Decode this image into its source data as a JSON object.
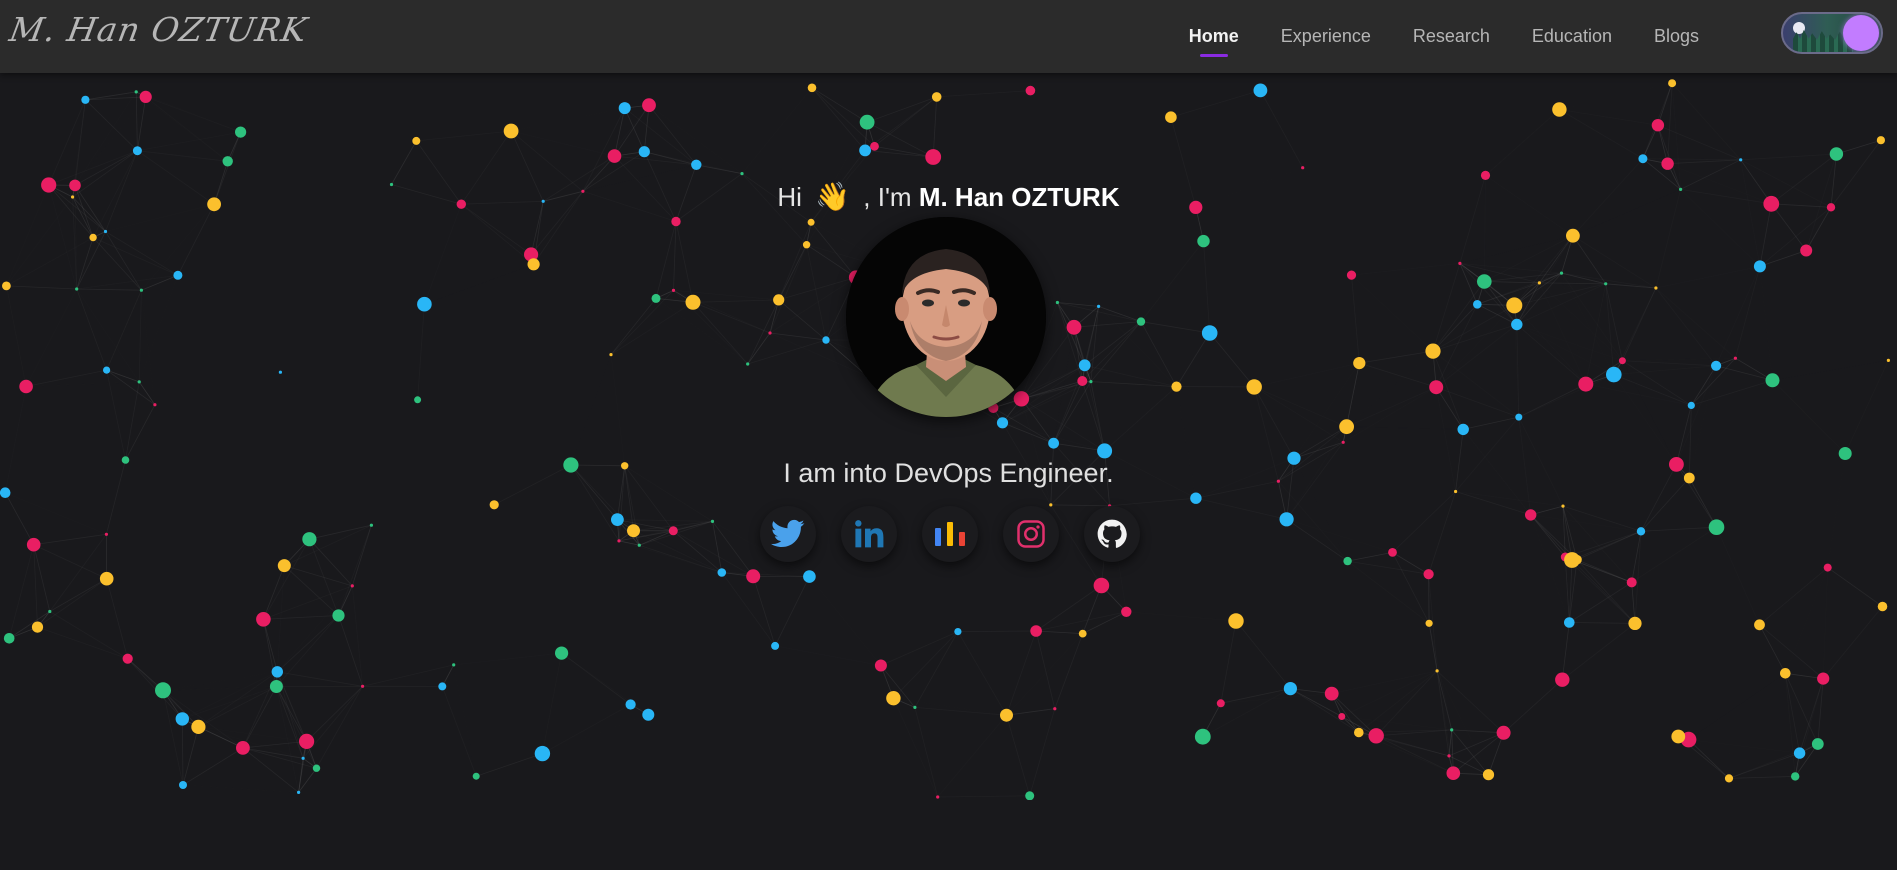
{
  "navbar": {
    "logo_text": "M. Han OZTURK",
    "links": [
      {
        "label": "Home",
        "active": true
      },
      {
        "label": "Experience",
        "active": false
      },
      {
        "label": "Research",
        "active": false
      },
      {
        "label": "Education",
        "active": false
      },
      {
        "label": "Blogs",
        "active": false
      }
    ],
    "accent_color": "#8a2be2",
    "theme_toggle": {
      "state": "dark",
      "knob_color": "#c27cff"
    }
  },
  "hero": {
    "greeting_prefix": "Hi",
    "wave_emoji": "👋",
    "greeting_middle": ", I'm",
    "name": "M. Han OZTURK",
    "tagline": "I am into DevOps Engineer.",
    "avatar_icon": "profile-photo"
  },
  "socials": [
    {
      "name": "twitter-icon",
      "color": "#4aa1eb"
    },
    {
      "name": "linkedin-icon",
      "color": "#1f77b4"
    },
    {
      "name": "stats-icon",
      "colors": [
        "#4285f4",
        "#fbbc05",
        "#ea4335"
      ]
    },
    {
      "name": "instagram-icon",
      "color": "#e1306c"
    },
    {
      "name": "github-icon",
      "color": "#f2f2f2"
    }
  ],
  "background": {
    "base_color": "#19191c",
    "particle_colors": [
      "#e91e63",
      "#2ec27e",
      "#29b6f6",
      "#fbc02d"
    ]
  }
}
